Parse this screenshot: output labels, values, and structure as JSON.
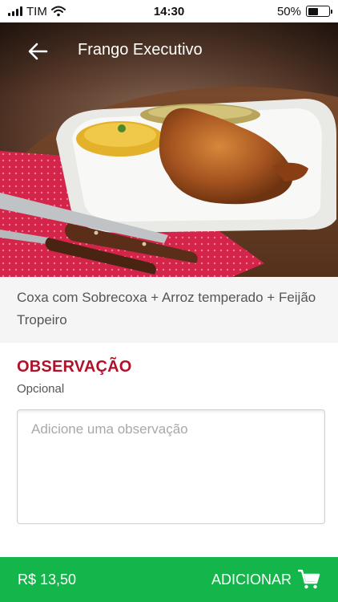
{
  "status_bar": {
    "carrier": "TIM",
    "time": "14:30",
    "battery_percent": "50%",
    "battery_level": 0.5
  },
  "header": {
    "title": "Frango Executivo",
    "back_icon": "arrow-left-icon"
  },
  "product": {
    "description": "Coxa com Sobrecoxa + Arroz temperado + Feijão Tropeiro"
  },
  "observation": {
    "title": "OBSERVAÇÃO",
    "subtitle": "Opcional",
    "placeholder": "Adicione uma observação",
    "value": ""
  },
  "footer": {
    "price": "R$ 13,50",
    "add_label": "ADICIONAR",
    "cart_icon": "cart-icon"
  },
  "colors": {
    "accent_red": "#b0122a",
    "footer_green": "#14b54a"
  }
}
